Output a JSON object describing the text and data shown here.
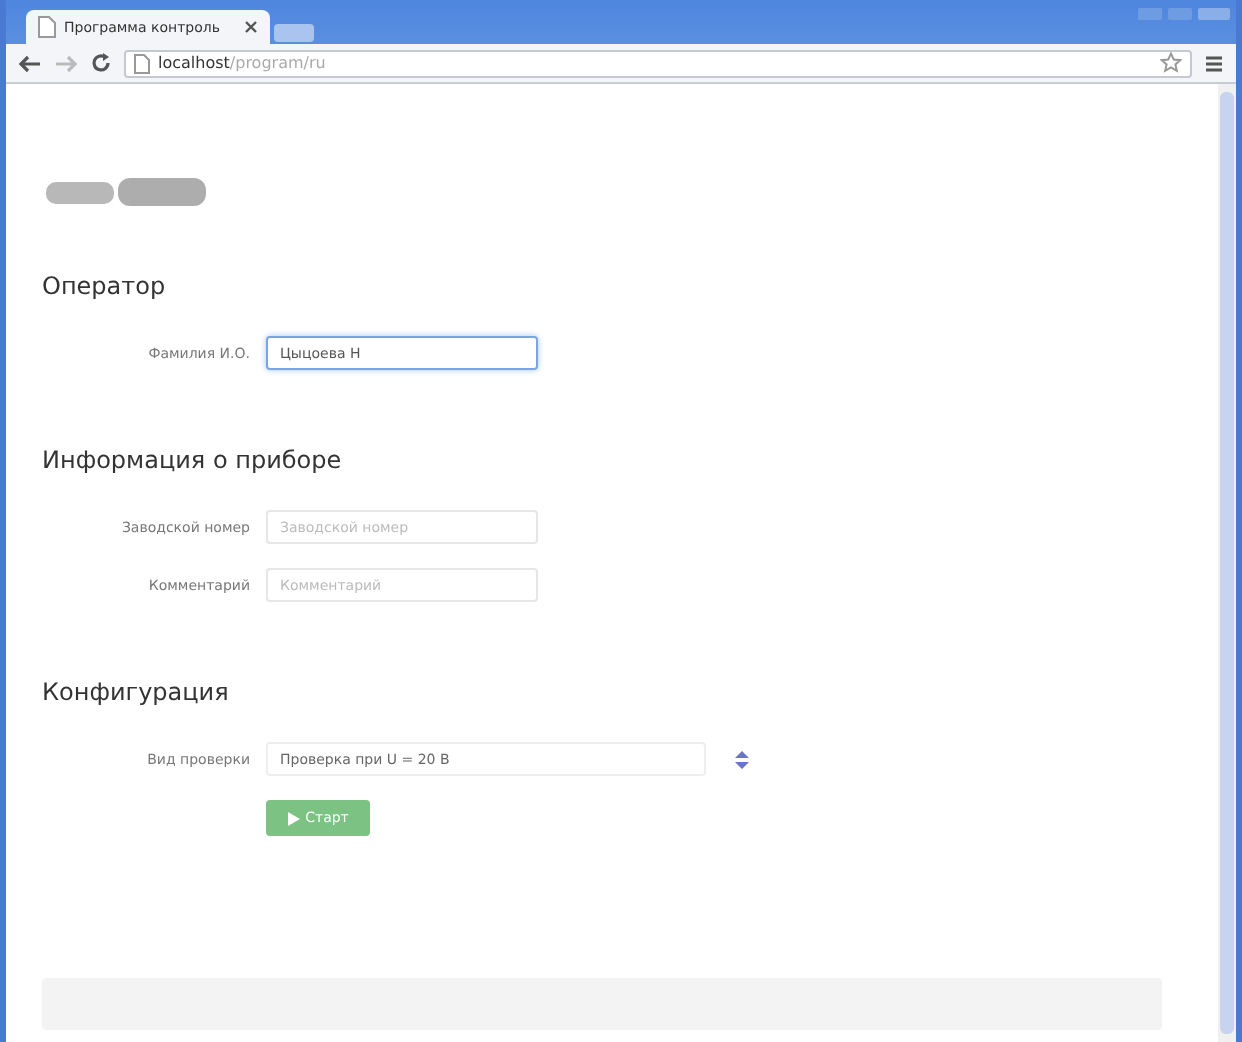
{
  "browser": {
    "tab_title": "Программа контроль",
    "url_host": "localhost",
    "url_path": "/program/ru"
  },
  "sections": [
    {
      "title": "Оператор",
      "fields": [
        {
          "kind": "input",
          "label": "Фамилия И.О.",
          "value": "Цыцоева Н",
          "focused": true
        }
      ]
    },
    {
      "title": "Информация о приборе",
      "fields": [
        {
          "kind": "input",
          "label": "Заводской номер",
          "placeholder": "Заводской номер",
          "focused": false
        },
        {
          "kind": "input",
          "label": "Комментарий",
          "placeholder": "Комментарий",
          "focused": false
        }
      ]
    },
    {
      "title": "Конфигурация",
      "fields": [
        {
          "kind": "select",
          "label": "Вид проверки",
          "value": "Проверка при U = 20 В",
          "focused": false
        }
      ]
    }
  ],
  "start_button": {
    "label": "Старт"
  }
}
